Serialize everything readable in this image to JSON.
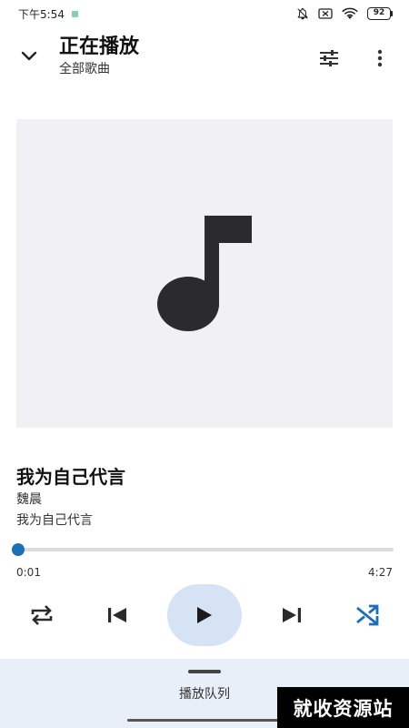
{
  "status_bar": {
    "time": "下午5:54",
    "battery": "92"
  },
  "header": {
    "title": "正在播放",
    "subtitle": "全部歌曲",
    "back_icon": "chevron-down-icon",
    "eq_icon": "equalizer-icon",
    "more_icon": "more-vert-icon"
  },
  "album_art": {
    "icon": "music-note-icon",
    "background": "#f1f0f5"
  },
  "song": {
    "title": "我为自己代言",
    "artist": "魏晨",
    "album": "我为自己代言"
  },
  "playback": {
    "current_time": "0:01",
    "total_time": "4:27",
    "progress": 0.004,
    "accent_color": "#1d6fb8"
  },
  "controls": {
    "repeat_icon": "repeat-icon",
    "prev_icon": "skip-previous-icon",
    "play_icon": "play-icon",
    "next_icon": "skip-next-icon",
    "shuffle_icon": "shuffle-icon",
    "shuffle_active": true
  },
  "queue": {
    "label": "播放队列"
  },
  "watermark": {
    "text": "就收资源站"
  }
}
